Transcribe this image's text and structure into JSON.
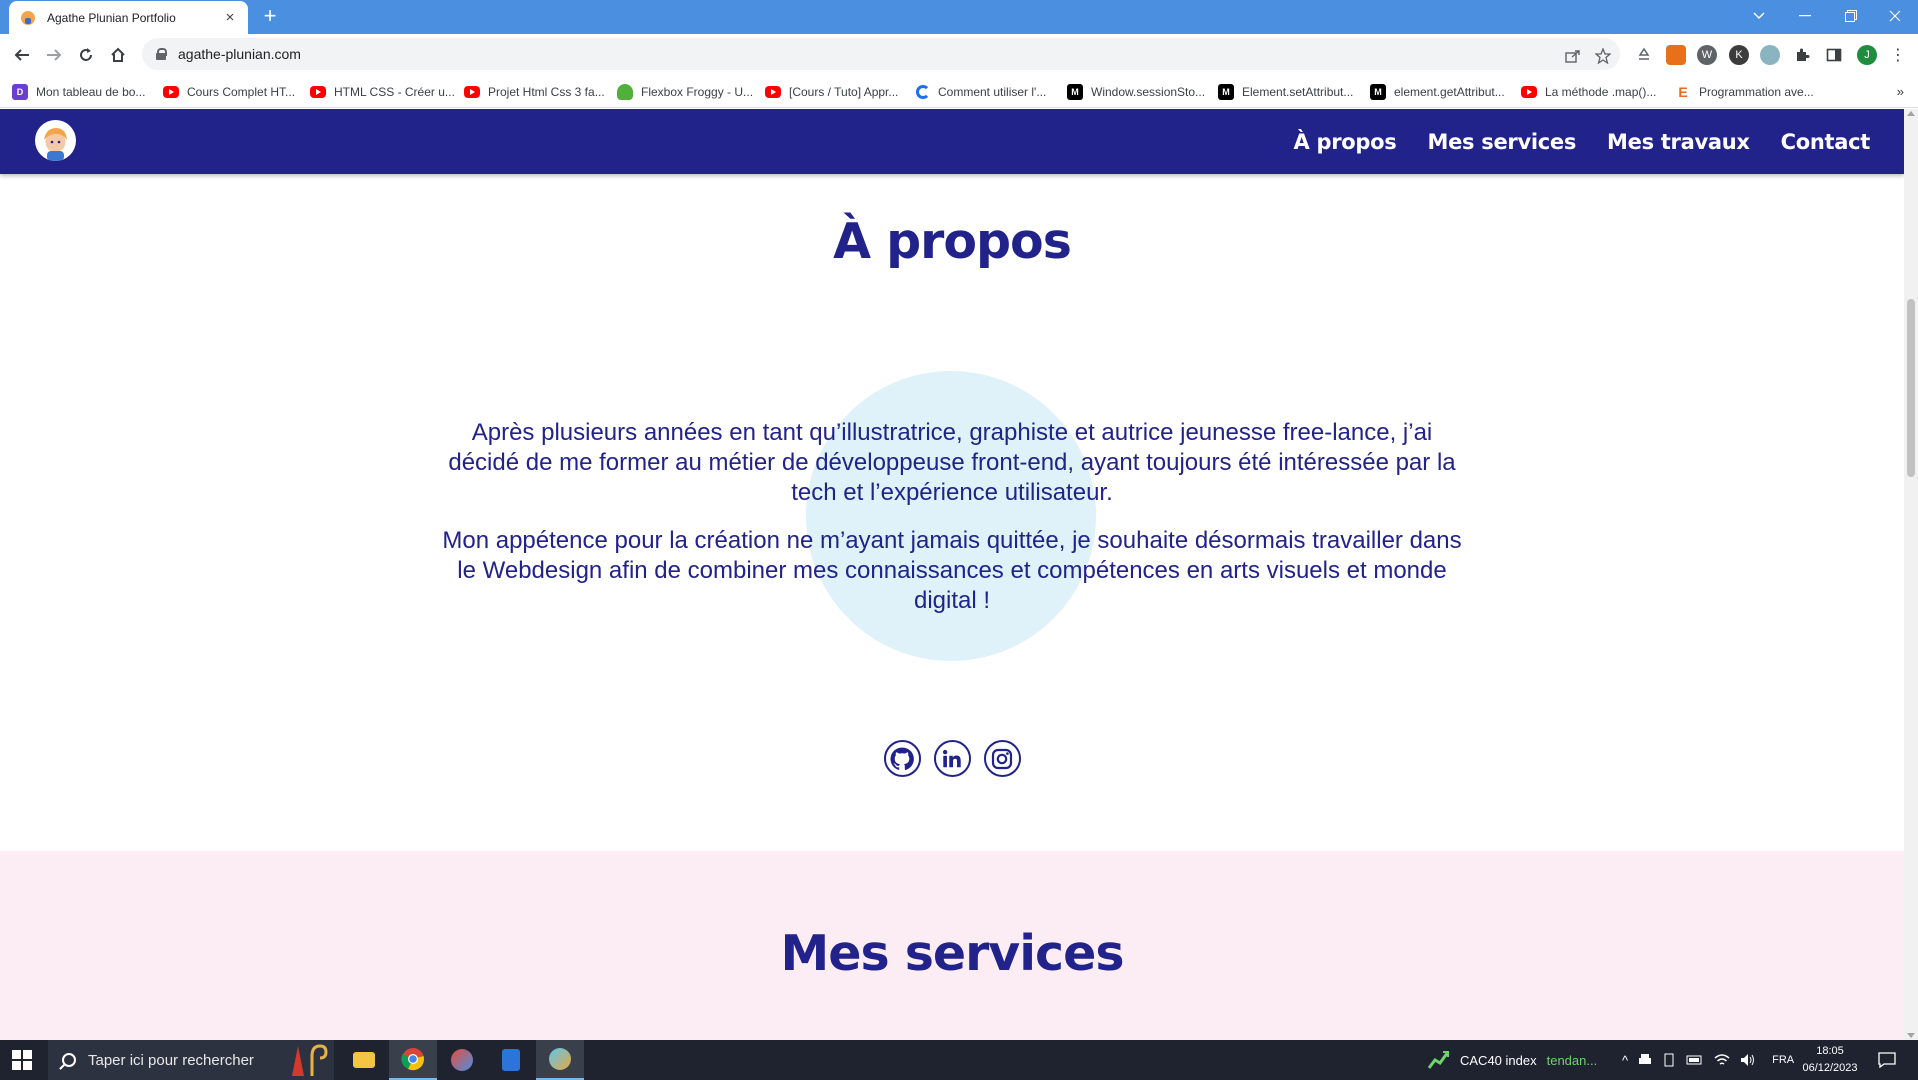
{
  "browser": {
    "tab_title": "Agathe Plunian Portfolio",
    "tab_close": "×",
    "new_tab": "+",
    "url": "agathe-plunian.com",
    "bookmarks": [
      {
        "label": "Mon tableau de bo...",
        "icon": "purple"
      },
      {
        "label": "Cours Complet HT...",
        "icon": "yt"
      },
      {
        "label": "HTML CSS - Créer u...",
        "icon": "yt"
      },
      {
        "label": "Projet Html Css 3 fa...",
        "icon": "yt"
      },
      {
        "label": "Flexbox Froggy - U...",
        "icon": "frog"
      },
      {
        "label": "[Cours / Tuto] Appr...",
        "icon": "yt"
      },
      {
        "label": "Comment utiliser l'...",
        "icon": "swirl"
      },
      {
        "label": "Window.sessionSto...",
        "icon": "mdn"
      },
      {
        "label": "Element.setAttribut...",
        "icon": "mdn"
      },
      {
        "label": "element.getAttribut...",
        "icon": "mdn"
      },
      {
        "label": "La méthode .map()...",
        "icon": "yt"
      },
      {
        "label": "Programmation ave...",
        "icon": "eicon"
      }
    ],
    "bookmarks_more": "»"
  },
  "site": {
    "nav": [
      "À propos",
      "Mes services",
      "Mes travaux",
      "Contact"
    ],
    "about": {
      "title": "À propos",
      "paragraphs": [
        "Après plusieurs années en tant qu’illustratrice, graphiste et autrice jeunesse free-lance, j’ai décidé de me former au métier de développeuse front-end, ayant toujours été intéressée par la tech et l’expérience utilisateur.",
        "Mon appétence pour la création ne m’ayant jamais quittée, je souhaite désormais travailler dans le Webdesign afin de combiner mes connaissances et compétences en arts visuels et monde digital !"
      ],
      "socials": [
        "github-icon",
        "linkedin-icon",
        "instagram-icon"
      ]
    },
    "services": {
      "title": "Mes services"
    },
    "colors": {
      "primary": "#22238a",
      "bubble": "#dff1f9",
      "services_bg": "#fcedf5"
    }
  },
  "taskbar": {
    "search_placeholder": "Taper ici pour rechercher",
    "stock_name": "CAC40 index",
    "stock_trend": "tendan...",
    "language": "FRA",
    "time": "18:05",
    "date": "06/12/2023"
  }
}
